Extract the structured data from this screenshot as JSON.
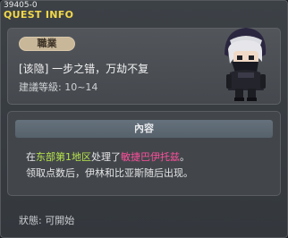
{
  "header": {
    "quest_id": "39405-0",
    "title": "QUEST INFO"
  },
  "summary": {
    "job_label": "職業",
    "quest_name": "[该隐] 一步之错，万劫不复",
    "level_text": "建議等級: 10~14"
  },
  "content": {
    "header_label": "內容",
    "line1_prefix": "在",
    "line1_location": "东部第1地区",
    "line1_middle": "处理了",
    "line1_target": "敏捷巴伊托兹",
    "line1_suffix": "。",
    "line2": "领取点数后，伊林和比亚斯随后出现。"
  },
  "status": {
    "text": "狀態: 可開始"
  },
  "colors": {
    "title": "#f2d84a",
    "location": "#b7e44a",
    "target": "#ff4f9b",
    "badge": "#c9b799"
  },
  "icons": {
    "npc": "hooded-character-portrait"
  }
}
